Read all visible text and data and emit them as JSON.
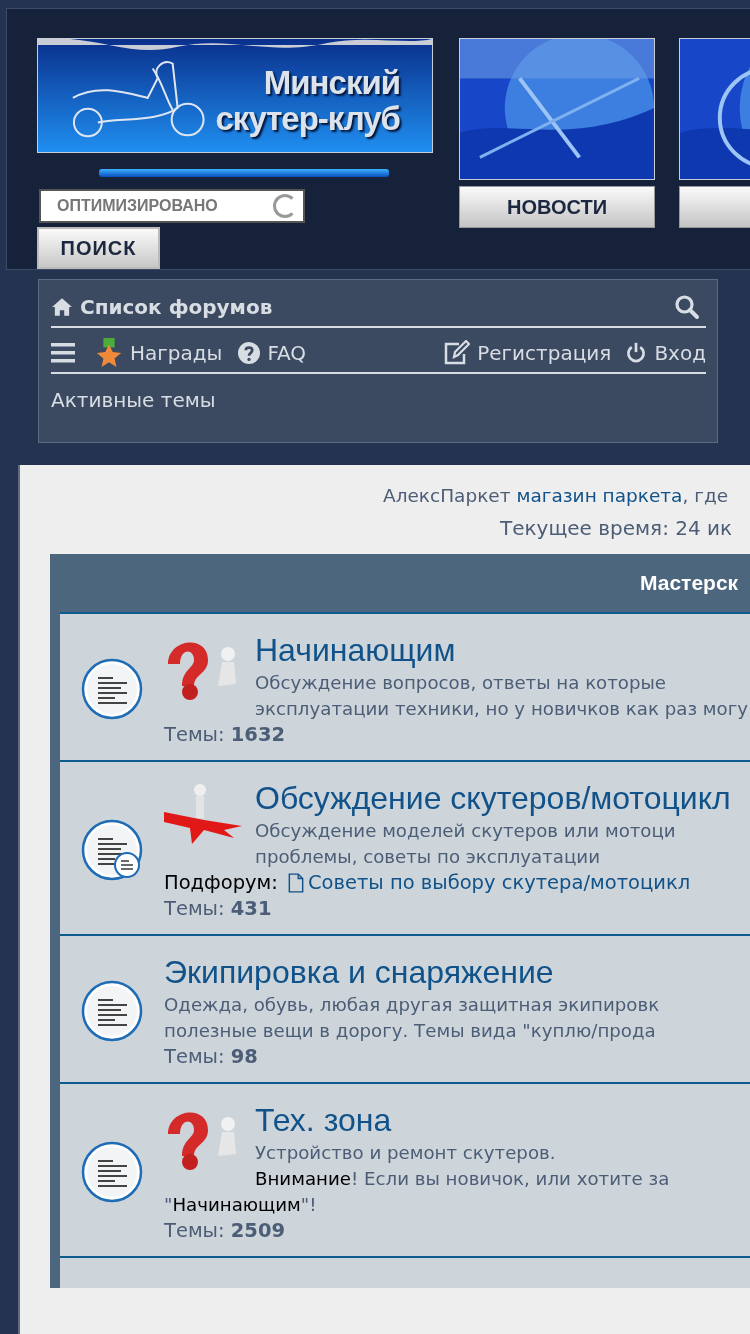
{
  "header": {
    "logo_lines": [
      "Минский",
      "скутер-клуб"
    ],
    "search": {
      "placeholder": "ОПТИМИЗИРОВАНО"
    },
    "search_button": "ПОИСК",
    "tiles": [
      {
        "label": "НОВОСТИ"
      }
    ]
  },
  "navbar": {
    "home": "Список форумов",
    "items": [
      {
        "label": "Награды",
        "kind": "awards"
      },
      {
        "label": "FAQ",
        "kind": "faq"
      },
      {
        "label": "Регистрация",
        "kind": "register"
      },
      {
        "label": "Вход",
        "kind": "login"
      }
    ],
    "active_topics": "Активные темы"
  },
  "notice": {
    "text": "АлексПаркет",
    "link": "магазин паркета",
    "tail": ", где"
  },
  "current_time": "Текущее время: 24 ик",
  "category": {
    "title": "Мастерск",
    "forums": [
      {
        "title": "Начинающим",
        "has_picture": true,
        "has_subforums": false,
        "description": [
          [
            {
              "text": "Обсуждение вопросов, ответы на которые",
              "kind": "plain"
            }
          ],
          [
            {
              "text": "эксплуатации техники, но у новичков как раз могу",
              "kind": "plain"
            }
          ]
        ],
        "topics_label": "Темы:",
        "topics": "1632"
      },
      {
        "title": "Обсуждение скутеров/мотоцикл",
        "has_picture": true,
        "has_subforums": true,
        "description": [
          [
            {
              "text": "Обсуждение моделей скутеров или мотоци",
              "kind": "plain"
            }
          ],
          [
            {
              "text": "проблемы, советы по эксплуатации",
              "kind": "plain"
            }
          ]
        ],
        "subforum_label": "Подфорум:",
        "subforum": "Советы по выбору скутера/мотоцикл",
        "topics_label": "Темы:",
        "topics": "431"
      },
      {
        "title": "Экипировка и снаряжение",
        "has_picture": false,
        "has_subforums": false,
        "description": [
          [
            {
              "text": "Одежда, обувь, любая другая защитная экипировк",
              "kind": "plain"
            }
          ],
          [
            {
              "text": "полезные вещи в дорогу. Темы вида \"куплю/прода",
              "kind": "plain"
            }
          ]
        ],
        "topics_label": "Темы:",
        "topics": "98"
      },
      {
        "title": "Тех. зона",
        "has_picture": true,
        "has_subforums": false,
        "description": [
          [
            {
              "text": "Устройство и ремонт скутеров.",
              "kind": "plain"
            }
          ],
          [
            {
              "text": "Внимание",
              "kind": "emphasis"
            },
            {
              "text": "! Если вы новичок, или хотите за",
              "kind": "plain"
            }
          ],
          [
            {
              "text": "\"",
              "kind": "plain"
            },
            {
              "text": "Начинающим",
              "kind": "emphasis"
            },
            {
              "text": "\"!",
              "kind": "plain"
            }
          ]
        ],
        "topics_label": "Темы:",
        "topics": "2509"
      }
    ]
  }
}
